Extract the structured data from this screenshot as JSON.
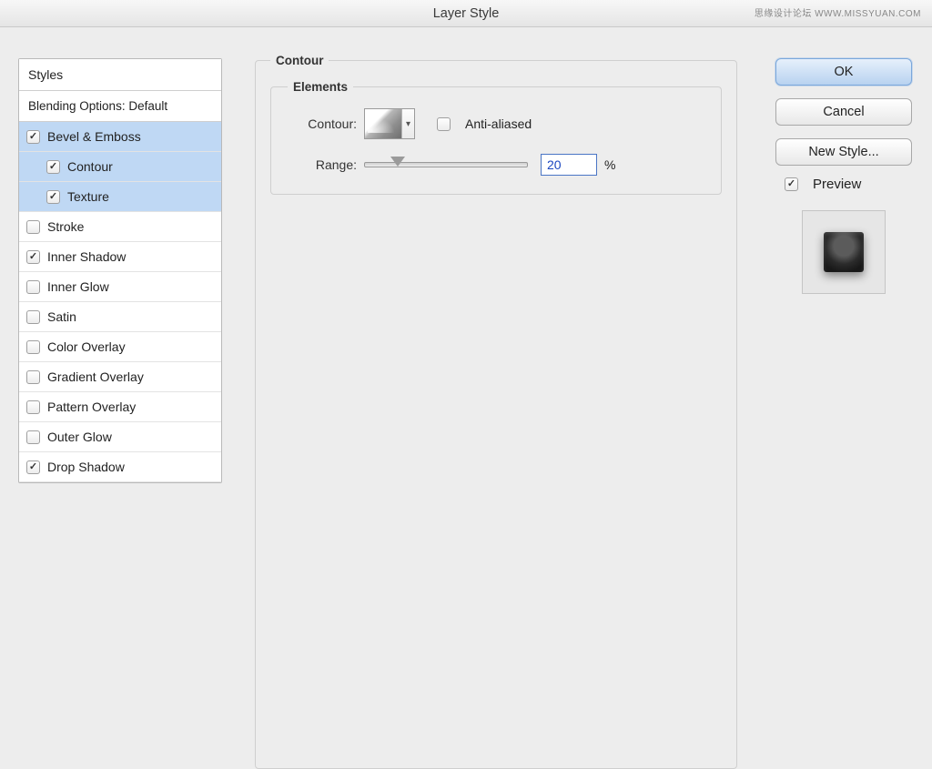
{
  "title": "Layer Style",
  "watermark": "思缘设计论坛  WWW.MISSYUAN.COM",
  "sidebar": {
    "styles_header": "Styles",
    "blending_header": "Blending Options: Default",
    "items": [
      {
        "label": "Bevel & Emboss",
        "checked": true,
        "selected": true,
        "sub": false
      },
      {
        "label": "Contour",
        "checked": true,
        "selected": true,
        "sub": true
      },
      {
        "label": "Texture",
        "checked": true,
        "selected": true,
        "sub": true
      },
      {
        "label": "Stroke",
        "checked": false,
        "selected": false,
        "sub": false
      },
      {
        "label": "Inner Shadow",
        "checked": true,
        "selected": false,
        "sub": false
      },
      {
        "label": "Inner Glow",
        "checked": false,
        "selected": false,
        "sub": false
      },
      {
        "label": "Satin",
        "checked": false,
        "selected": false,
        "sub": false
      },
      {
        "label": "Color Overlay",
        "checked": false,
        "selected": false,
        "sub": false
      },
      {
        "label": "Gradient Overlay",
        "checked": false,
        "selected": false,
        "sub": false
      },
      {
        "label": "Pattern Overlay",
        "checked": false,
        "selected": false,
        "sub": false
      },
      {
        "label": "Outer Glow",
        "checked": false,
        "selected": false,
        "sub": false
      },
      {
        "label": "Drop Shadow",
        "checked": true,
        "selected": false,
        "sub": false
      }
    ]
  },
  "main": {
    "section_title": "Contour",
    "elements_title": "Elements",
    "contour_label": "Contour:",
    "anti_aliased_label": "Anti-aliased",
    "anti_aliased_checked": false,
    "range_label": "Range:",
    "range_value": "20",
    "range_pct_symbol": "%",
    "range_slider_pct": 20
  },
  "actions": {
    "ok": "OK",
    "cancel": "Cancel",
    "new_style": "New Style...",
    "preview_label": "Preview",
    "preview_checked": true
  }
}
